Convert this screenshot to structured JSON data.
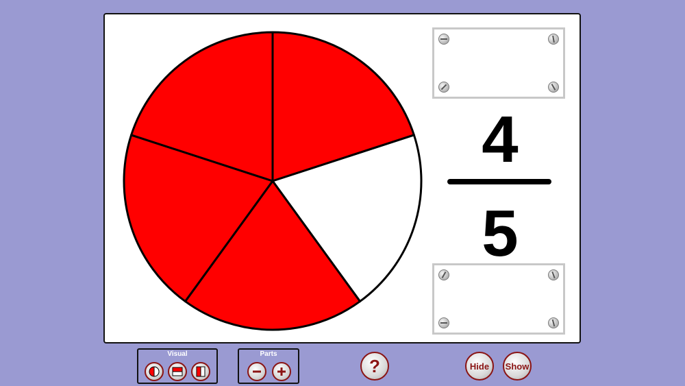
{
  "fraction": {
    "numerator": "4",
    "denominator": "5"
  },
  "pie": {
    "parts": 5,
    "shaded": 4,
    "shade_color": "#ff0000",
    "empty_color": "#ffffff",
    "outline_color": "#000000"
  },
  "controls": {
    "visual_label": "Visual",
    "visual_icons": [
      "pie-visual-icon",
      "horizontal-bar-visual-icon",
      "vertical-bar-visual-icon"
    ],
    "parts_label": "Parts",
    "minus_icon": "minus-icon",
    "plus_icon": "plus-icon",
    "help_label": "?",
    "hide_label": "Hide",
    "show_label": "Show"
  },
  "colors": {
    "background": "#9a9ad2",
    "accent": "#8a1414",
    "board": "#ffffff"
  }
}
